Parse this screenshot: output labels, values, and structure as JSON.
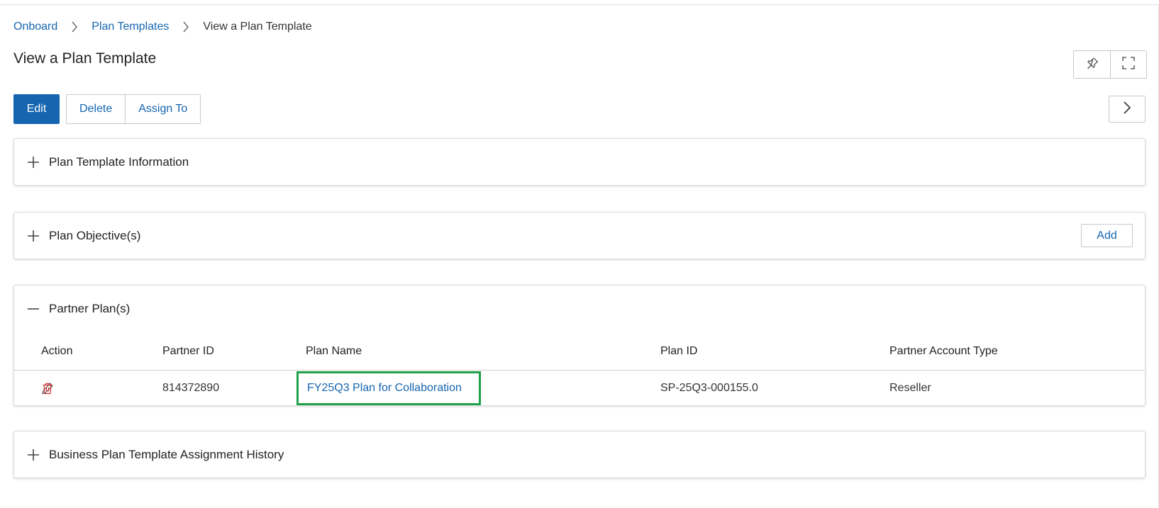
{
  "breadcrumb": {
    "items": [
      {
        "label": "Onboard"
      },
      {
        "label": "Plan Templates"
      }
    ],
    "current": "View a Plan Template"
  },
  "page": {
    "title": "View a Plan Template"
  },
  "toolbar": {
    "edit_label": "Edit",
    "delete_label": "Delete",
    "assign_label": "Assign To"
  },
  "icons": {
    "pin": "pin-icon",
    "fullscreen": "fullscreen-icon",
    "next": "chevron-right-icon"
  },
  "sections": {
    "plan_template_information": {
      "title": "Plan Template Information",
      "expanded": false
    },
    "plan_objectives": {
      "title": "Plan Objective(s)",
      "expanded": false,
      "add_label": "Add"
    },
    "partner_plans": {
      "title": "Partner Plan(s)",
      "expanded": true,
      "columns": [
        "Action",
        "Partner ID",
        "Plan Name",
        "Plan ID",
        "Partner Account Type"
      ],
      "rows": [
        {
          "partner_id": "814372890",
          "plan_name": "FY25Q3 Plan for Collaboration",
          "plan_id": "SP-25Q3-000155.0",
          "partner_account_type": "Reseller"
        }
      ]
    },
    "assignment_history": {
      "title": "Business Plan Template Assignment History",
      "expanded": false
    }
  },
  "colors": {
    "primary": "#1565b0",
    "link": "#1565b0",
    "delete_icon": "#d32f2f",
    "highlight_border": "#20a24a"
  }
}
